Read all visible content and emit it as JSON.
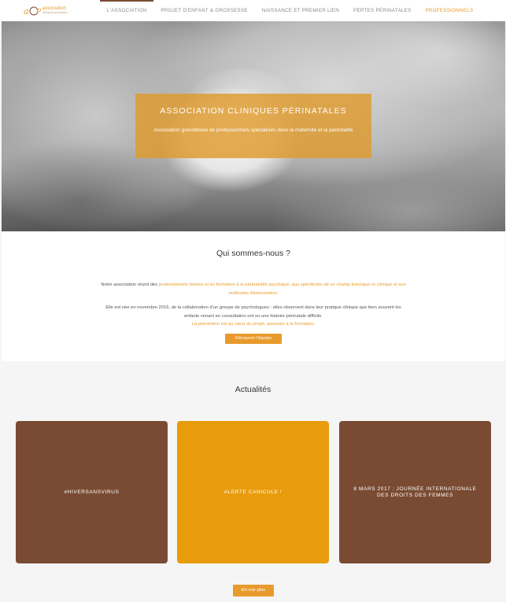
{
  "header": {
    "logo": {
      "mark": "aCP",
      "line1": "association",
      "line2": "cliniques périnatales"
    },
    "nav": [
      {
        "label": "L'ASSOCIATION",
        "active": true
      },
      {
        "label": "PROJET D'ENFANT & GROSSESSE"
      },
      {
        "label": "NAISSANCE ET PREMIER LIEN"
      },
      {
        "label": "PERTES PÉRINATALES"
      },
      {
        "label": "PROFESSIONNELS",
        "accent": true
      }
    ]
  },
  "hero": {
    "title": "ASSOCIATION CLINIQUES PÉRINATALES",
    "subtitle": "Association grenobloise de professionnels spécialisés dans la maternité et la parentalité"
  },
  "about": {
    "title": "Qui sommes-nous ?",
    "p1_start": "Notre association réunit des ",
    "p1_highlight": "professionnels formés et en formation à la périnatalité psychique, aux spécificités de ce champ théorique et clinique et aux méthodes d'intervention.",
    "p2_text": "Elle est née en novembre 2016, de la collaboration d'un groupe de psychologues : elles observent dans leur pratique clinique que bien souvent les enfants venant en consultation ont eu une histoire périnatale difficile.",
    "p2_highlight": "La prévention est au cœur du projet, associée à la formation.",
    "button": "Découvrir l'équipe"
  },
  "news": {
    "title": "Actualités",
    "cards": [
      {
        "label": "#HIVERSANSVIRUS"
      },
      {
        "label": "ALERTE CANICULE !"
      },
      {
        "label": "8 MARS 2017 : JOURNÉE INTERNATIONALE DES DROITS DES FEMMES"
      }
    ],
    "more_button": "En voir plus"
  },
  "colors": {
    "accent": "#e89b2c",
    "brown": "#7a4b33",
    "orange_card": "#e89b0b"
  }
}
